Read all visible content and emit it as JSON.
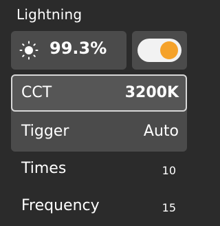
{
  "header": {
    "title": "Lightning"
  },
  "brightness": {
    "icon": "sun-icon",
    "value": "99.3%"
  },
  "power_toggle": {
    "state": "on",
    "accent": "#f5a22a"
  },
  "settings": {
    "cct": {
      "label": "CCT",
      "value": "3200K"
    },
    "trigger": {
      "label": "Tigger",
      "value": "Auto"
    }
  },
  "params": {
    "times": {
      "label": "Times",
      "value": "10"
    },
    "frequency": {
      "label": "Frequency",
      "value": "15"
    }
  }
}
